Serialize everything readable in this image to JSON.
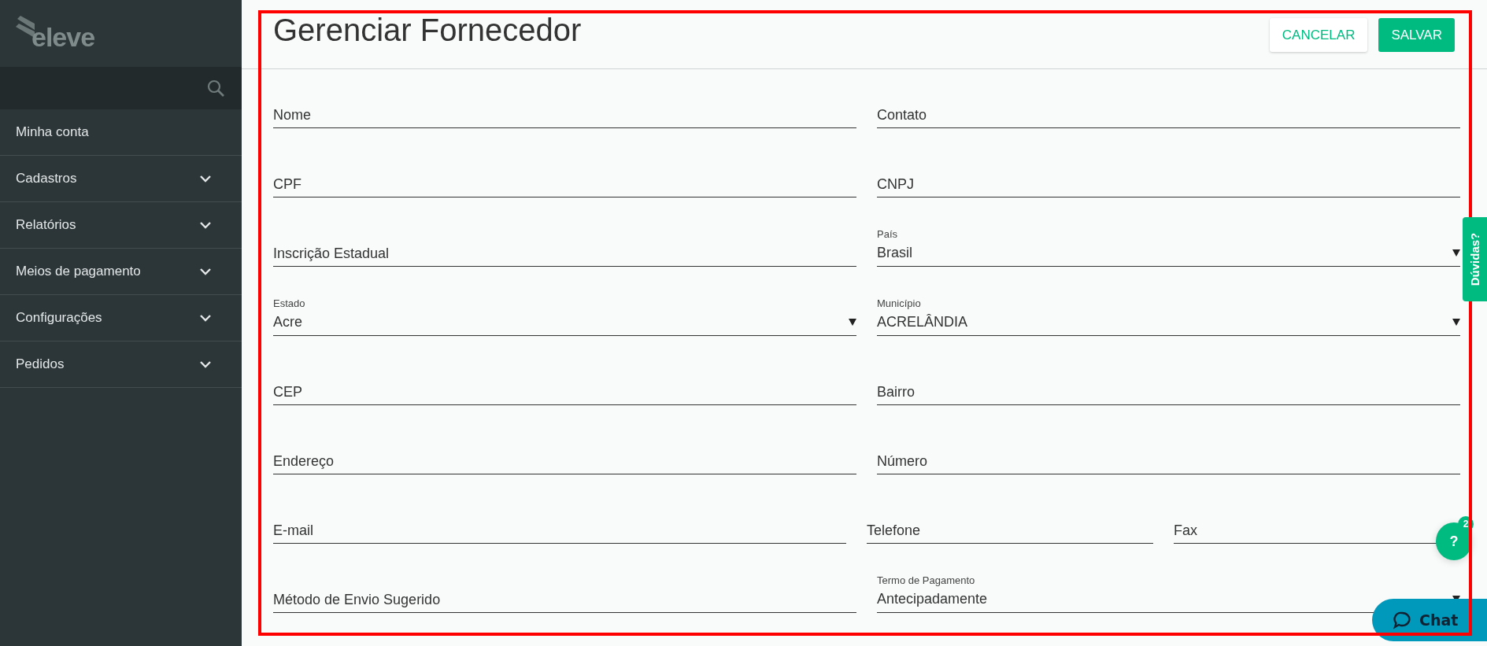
{
  "sidebar": {
    "logo": "eleve",
    "items": [
      {
        "label": "Minha conta",
        "expandable": false
      },
      {
        "label": "Cadastros",
        "expandable": true
      },
      {
        "label": "Relatórios",
        "expandable": true
      },
      {
        "label": "Meios de pagamento",
        "expandable": true
      },
      {
        "label": "Configurações",
        "expandable": true
      },
      {
        "label": "Pedidos",
        "expandable": true
      }
    ]
  },
  "header": {
    "title": "Gerenciar Fornecedor",
    "buttons": [
      {
        "label": "CANCELAR",
        "kind": "outline"
      },
      {
        "label": "SALVAR",
        "kind": "primary"
      }
    ]
  },
  "form": {
    "rows": [
      {
        "fields": [
          {
            "kind": "text",
            "placeholder": "Nome"
          },
          {
            "kind": "text",
            "placeholder": "Contato"
          }
        ]
      },
      {
        "fields": [
          {
            "kind": "text",
            "placeholder": "CPF"
          },
          {
            "kind": "text",
            "placeholder": "CNPJ"
          }
        ]
      },
      {
        "fields": [
          {
            "kind": "text",
            "placeholder": "Inscrição Estadual"
          },
          {
            "kind": "select",
            "label": "País",
            "value": "Brasil"
          }
        ]
      },
      {
        "fields": [
          {
            "kind": "select",
            "label": "Estado",
            "value": "Acre"
          },
          {
            "kind": "select",
            "label": "Município",
            "value": "ACRELÂNDIA"
          }
        ]
      },
      {
        "fields": [
          {
            "kind": "text",
            "placeholder": "CEP"
          },
          {
            "kind": "text",
            "placeholder": "Bairro"
          }
        ]
      },
      {
        "fields": [
          {
            "kind": "text",
            "placeholder": "Endereço"
          },
          {
            "kind": "text",
            "placeholder": "Número"
          }
        ]
      },
      {
        "fields": [
          {
            "kind": "text",
            "placeholder": "E-mail"
          },
          {
            "kind": "text",
            "placeholder": "Telefone"
          },
          {
            "kind": "text",
            "placeholder": "Fax"
          }
        ]
      },
      {
        "fields": [
          {
            "kind": "text",
            "placeholder": "Método de Envio Sugerido"
          },
          {
            "kind": "select",
            "label": "Termo de Pagamento",
            "value": "Antecipadamente"
          }
        ]
      }
    ]
  },
  "feedback_tab": {
    "label": "Dúvidas?"
  },
  "help_bubble": {
    "label": "?",
    "badge": "2"
  },
  "chat_button": {
    "label": "Chat"
  }
}
